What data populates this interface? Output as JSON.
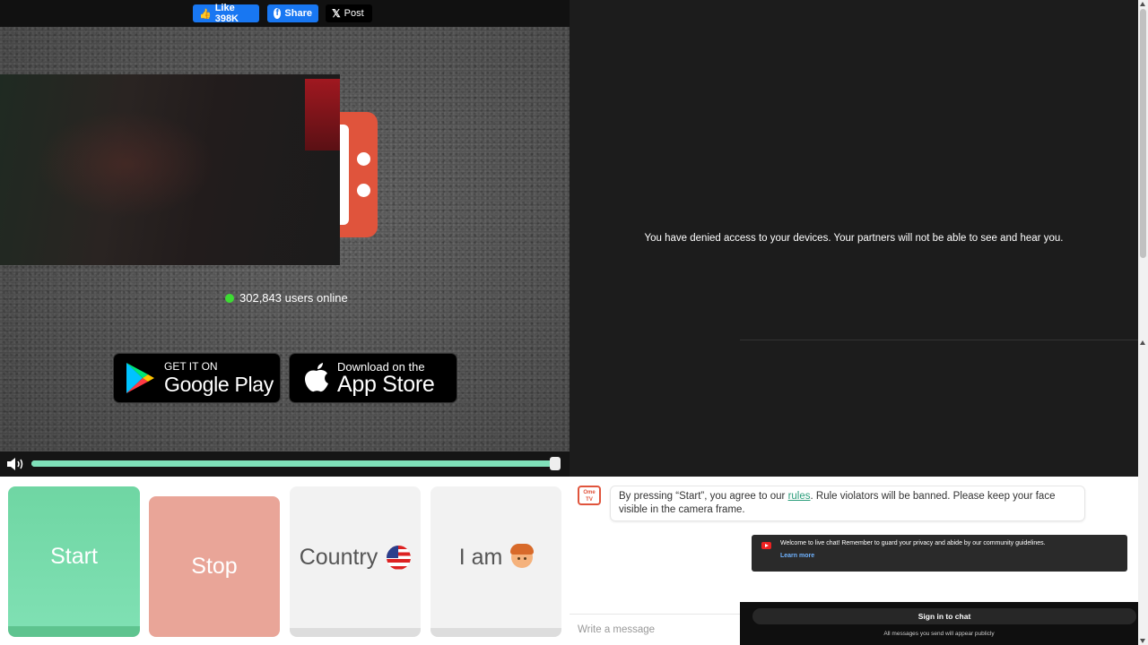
{
  "social": {
    "like_label": "Like 398K",
    "share_label": "Share",
    "post_label": "Post"
  },
  "self_cam": {
    "logo_icon": "ometv-logo-badge"
  },
  "online": {
    "count_text": "302,843 users online",
    "status_color": "#3ddc33"
  },
  "stores": {
    "google_small": "GET IT ON",
    "google_big": "Google Play",
    "apple_small": "Download on the",
    "apple_big": "App Store"
  },
  "volume": {
    "level": 1.0,
    "accent": "#7fe0b9"
  },
  "partner": {
    "denied_message": "You have denied access to your devices. Your partners will not be able to see and hear you."
  },
  "controls": {
    "start_label": "Start",
    "stop_label": "Stop",
    "country_label": "Country",
    "iam_label": "I am",
    "start_color": "#6fd6a3",
    "stop_color": "#e9a598"
  },
  "chat": {
    "icon_text": "Ome TV",
    "rules_pre": "By pressing “Start”, you agree to our ",
    "rules_link": "rules",
    "rules_post": ". Rule violators will be banned. Please keep your face visible in the camera frame.",
    "notice_text": "Welcome to live chat! Remember to guard your privacy and abide by our community guidelines.",
    "learn_more": "Learn more",
    "input_placeholder": "Write a message",
    "signin_label": "Sign in to chat",
    "signin_note": "All messages you send will appear publicly"
  }
}
